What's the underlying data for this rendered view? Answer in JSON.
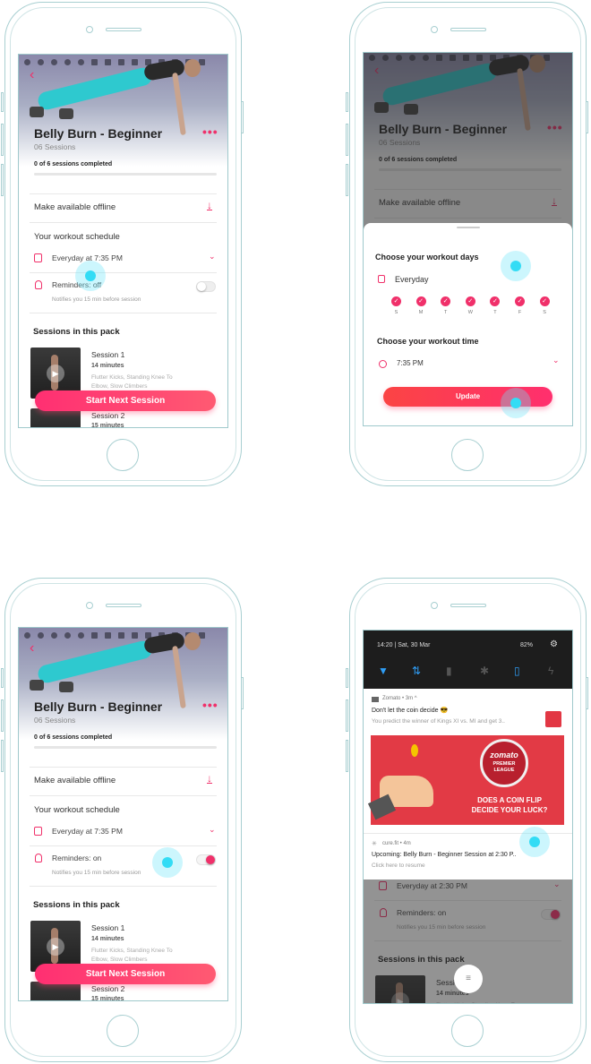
{
  "colors": {
    "accent": "#f0306a",
    "touch": "#33dcf5",
    "frame": "#a8cfd1"
  },
  "app": {
    "back_icon": "chevron-left-icon",
    "title": "Belly Burn - Beginner",
    "sessions_count": "06 Sessions",
    "progress_text": "0 of 6 sessions completed",
    "progress_fraction": 0,
    "more_icon": "more-dots-icon",
    "offline_label": "Make available offline",
    "schedule_heading": "Your workout schedule",
    "reminder_sub": "Notifies you 15 min before session",
    "sessions_heading": "Sessions in this pack",
    "sessions": [
      {
        "name": "Session 1",
        "duration": "14 minutes",
        "exercises": "Flutter Kicks, Standing Knee To",
        "exercises_2": "Elbow, Slow Climbers"
      },
      {
        "name": "Session 2",
        "duration": "15 minutes"
      }
    ],
    "cta": "Start Next Session"
  },
  "phones": [
    {
      "schedule": "Everyday at 7:35 PM",
      "reminders": "Reminders: off",
      "reminders_on": false
    },
    {
      "schedule": "Everyday at 7:35 PM",
      "reminders": "Reminders: off",
      "reminders_on": false,
      "sheet": {
        "days_heading": "Choose your workout days",
        "days_value": "Everyday",
        "days": [
          "S",
          "M",
          "T",
          "W",
          "T",
          "F",
          "S"
        ],
        "days_selected": [
          true,
          true,
          true,
          true,
          true,
          true,
          true
        ],
        "time_heading": "Choose your workout time",
        "time_value": "7:35 PM",
        "update": "Update"
      }
    },
    {
      "schedule": "Everyday at 7:35 PM",
      "reminders": "Reminders: on",
      "reminders_on": true
    },
    {
      "schedule": "Everyday at 2:30 PM",
      "reminders": "Reminders: on",
      "reminders_on": true,
      "shade": {
        "time": "14:20 | Sat, 30 Mar",
        "battery": "82%",
        "notif1": {
          "app": "Zomato • 3m ^",
          "title": "Don't let the coin decide 😎",
          "body": "You predict the winner of Kings XI vs. MI and get 3..",
          "banner_logo": "zomato",
          "banner_sub1": "PREMIER",
          "banner_sub2": "LEAGUE",
          "banner_line1": "DOES A COIN FLIP",
          "banner_line2": "DECIDE YOUR LUCK?"
        },
        "notif2": {
          "app": "cure.fit • 4m",
          "title": "Upcoming: Belly Burn - Beginner Session at 2:30 P..",
          "body": "Click here to resume"
        }
      }
    }
  ]
}
